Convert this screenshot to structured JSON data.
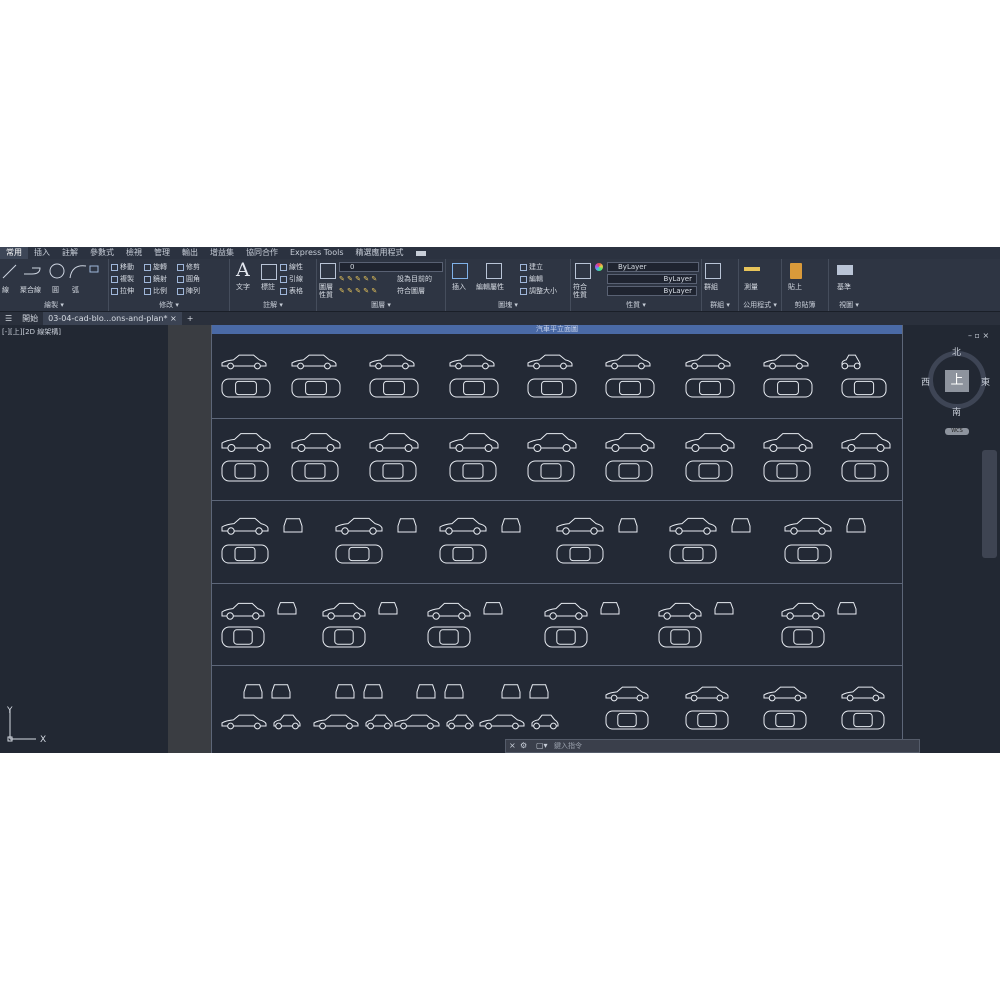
{
  "ribbon_tabs": [
    "常用",
    "插入",
    "註解",
    "參數式",
    "檢視",
    "管理",
    "輸出",
    "增益集",
    "協同合作",
    "Express Tools",
    "精選應用程式"
  ],
  "draw_panel": {
    "title": "繪製 ▾",
    "polyline": "聚合線",
    "circle": "圓",
    "arc": "弧",
    "line_short": "線"
  },
  "modify_panel": {
    "title": "修改 ▾",
    "move": "移動",
    "rotate": "旋轉",
    "trim": "修剪",
    "copy": "複製",
    "mirror": "鏡射",
    "fillet": "圓角",
    "stretch": "拉伸",
    "scale": "比例",
    "array": "陣列"
  },
  "annotation_panel": {
    "title": "註解 ▾",
    "text": "文字",
    "dimension": "標註",
    "linear": "線性",
    "leader": "引線",
    "table": "表格"
  },
  "layers_panel": {
    "title": "圖層 ▾",
    "layer_props": "圖層性質",
    "current_layer": "0",
    "make_current": "設為目前的",
    "match_layer": "符合圖層"
  },
  "block_panel": {
    "title": "圖塊 ▾",
    "insert": "插入",
    "edit_attr": "編輯屬性",
    "create": "建立",
    "edit": "編輯"
  },
  "block_side": {
    "label": "調整大小"
  },
  "properties_panel": {
    "title": "性質 ▾",
    "match": "符合性質",
    "color": "ByLayer",
    "linetype": "ByLayer",
    "lineweight": "ByLayer"
  },
  "groups_panel": {
    "title": "群組 ▾",
    "group": "群組"
  },
  "utilities_panel": {
    "title": "公用程式 ▾",
    "measure": "測量"
  },
  "clipboard_panel": {
    "title": "剪貼簿",
    "paste": "貼上"
  },
  "view_panel": {
    "title": "視圖 ▾",
    "base": "基準"
  },
  "file_tabs": {
    "start": "開始",
    "current": "03-04-cad-blo...ons-and-plan*",
    "close": "×",
    "add": "+"
  },
  "viewport_label": "[-][上][2D 線架構]",
  "sheet_title": "汽車平立面圖",
  "viewcube": {
    "top": "上",
    "north": "北",
    "south": "南",
    "east": "東",
    "west": "西",
    "wcs": "WCS"
  },
  "command_line": {
    "placeholder": "鍵入指令"
  },
  "ucs": {
    "x": "X",
    "y": "Y"
  },
  "colors": {
    "background": "#222833",
    "ribbon": "#2e3543",
    "linework": "#e8ecf2",
    "sheet_header": "#4a6aa6"
  }
}
